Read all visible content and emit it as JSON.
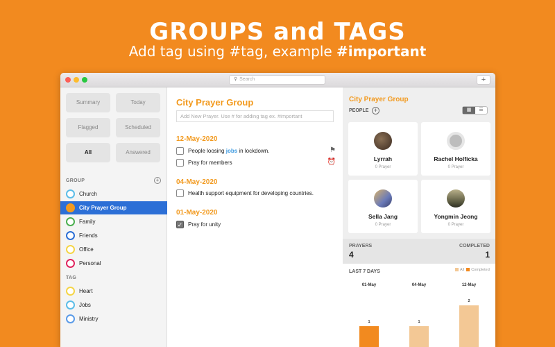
{
  "hero": {
    "title": "GROUPS and TAGS",
    "subtitle_prefix": "Add tag using #tag, example ",
    "subtitle_tag": "#important"
  },
  "window": {
    "search_placeholder": "Search",
    "add_label": "+"
  },
  "sidebar": {
    "filters": [
      {
        "label": "Summary"
      },
      {
        "label": "Today"
      },
      {
        "label": "Flagged"
      },
      {
        "label": "Scheduled"
      },
      {
        "label": "All",
        "active": true
      },
      {
        "label": "Answered"
      }
    ],
    "group_title": "GROUP",
    "groups": [
      {
        "label": "Church",
        "color": "#5bbde8"
      },
      {
        "label": "City Prayer Group",
        "color": "#F29A1F",
        "selected": true
      },
      {
        "label": "Family",
        "color": "#4caf50"
      },
      {
        "label": "Friends",
        "color": "#2c6fd6"
      },
      {
        "label": "Office",
        "color": "#f5d547"
      },
      {
        "label": "Personal",
        "color": "#e0245e"
      }
    ],
    "tag_title": "TAG",
    "tags": [
      {
        "label": "Heart",
        "color": "#f5d547"
      },
      {
        "label": "Jobs",
        "color": "#5bbde8"
      },
      {
        "label": "Ministry",
        "color": "#5b9be8"
      }
    ]
  },
  "center": {
    "title": "City Prayer Group",
    "input_placeholder": "Add New Prayer. Use # for adding tag ex. #important",
    "sections": [
      {
        "date": "12-May-2020",
        "prayers": [
          {
            "before": "People loosing ",
            "tag": "jobs",
            "after": " in lockdown.",
            "checked": false,
            "icon": "flag-icon"
          },
          {
            "before": "Pray for members",
            "tag": "",
            "after": "",
            "checked": false,
            "icon": "alarm-icon"
          }
        ]
      },
      {
        "date": "04-May-2020",
        "prayers": [
          {
            "before": "Health support equipment for developing countries.",
            "tag": "",
            "after": "",
            "checked": false
          }
        ]
      },
      {
        "date": "01-May-2020",
        "prayers": [
          {
            "before": "Pray for unity",
            "tag": "",
            "after": "",
            "checked": true
          }
        ]
      }
    ]
  },
  "right": {
    "title": "City Prayer Group",
    "people_label": "PEOPLE",
    "people": [
      {
        "name": "Lyrrah",
        "sub": "0 Prayer"
      },
      {
        "name": "Rachel Holficka",
        "sub": "0 Prayer"
      },
      {
        "name": "Sella Jang",
        "sub": "0 Prayer"
      },
      {
        "name": "Yongmin Jeong",
        "sub": "0 Prayer"
      }
    ],
    "prayers_label": "PRAYERS",
    "prayers_value": "4",
    "completed_label": "COMPLETED",
    "completed_value": "1",
    "chart_title": "LAST 7 DAYS",
    "legend_all": "All",
    "legend_completed": "Completed",
    "colors": {
      "all": "#f3c895",
      "completed": "#F28A1F"
    }
  },
  "chart_data": {
    "type": "bar",
    "title": "LAST 7 DAYS",
    "categories": [
      "01-May",
      "04-May",
      "12-May"
    ],
    "series": [
      {
        "name": "All",
        "values": [
          1,
          1,
          2
        ]
      },
      {
        "name": "Completed",
        "values": [
          1,
          0,
          0
        ]
      }
    ],
    "ylim": [
      0,
      2
    ]
  }
}
